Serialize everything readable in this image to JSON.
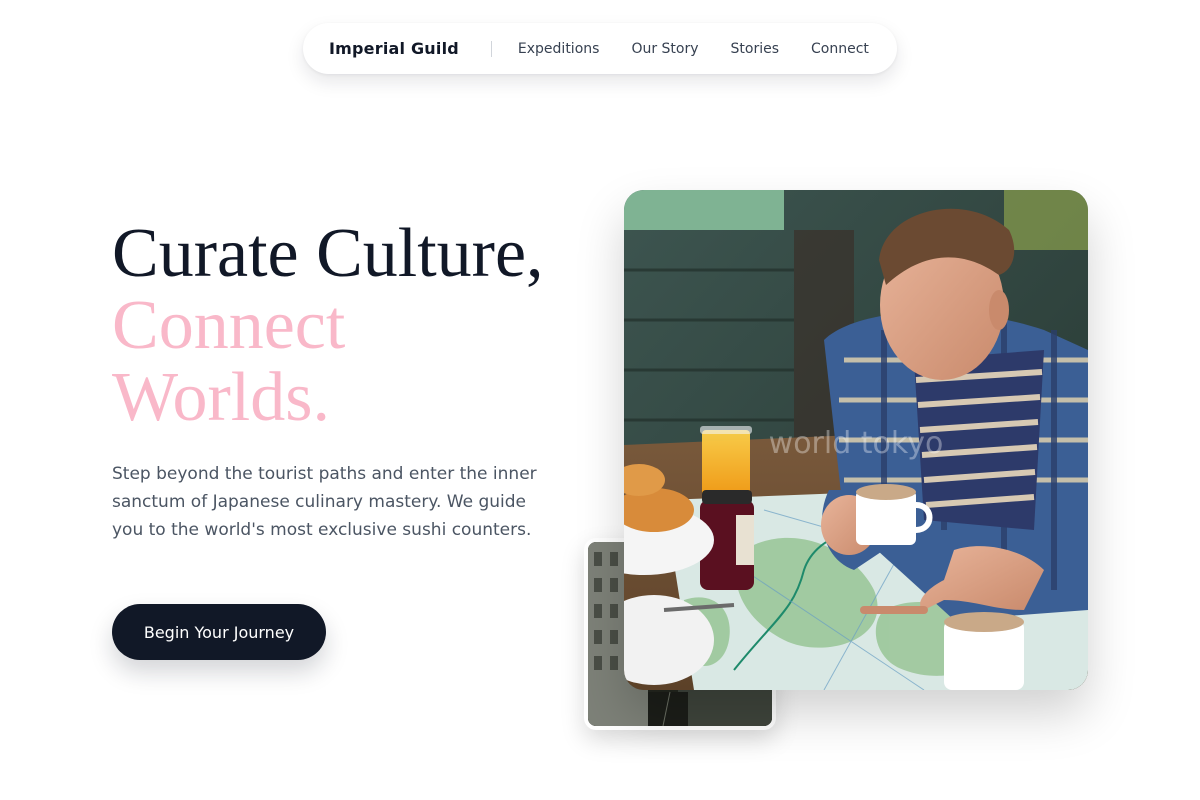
{
  "nav": {
    "brand": "Imperial Guild",
    "links": [
      "Expeditions",
      "Our Story",
      "Stories",
      "Connect"
    ]
  },
  "hero": {
    "title_line1": "Curate Culture,",
    "title_line2": "Connect",
    "title_line3": "Worlds.",
    "description": "Step beyond the tourist paths and enter the inner sanctum of Japanese culinary mastery. We guide you to the world's most exclusive sushi counters.",
    "cta_label": "Begin Your Journey"
  },
  "images": {
    "main_watermark": "world tokyo",
    "main_alt": "Man reading a map over breakfast",
    "secondary_alt": "Narrow city street"
  },
  "colors": {
    "dark": "#111827",
    "accent_pink": "#f9b8c9",
    "body_text": "#4b5563"
  }
}
